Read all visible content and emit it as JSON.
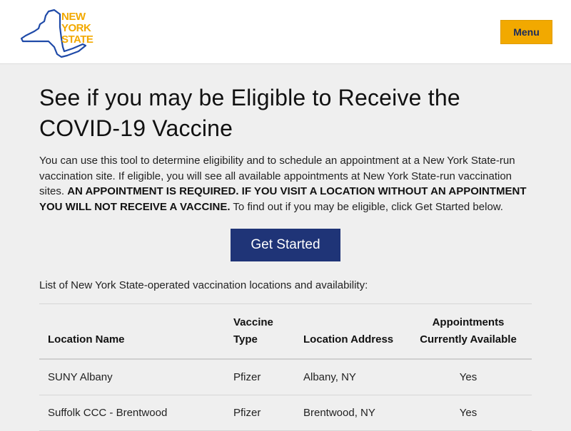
{
  "header": {
    "logo_lines": [
      "NEW",
      "YORK",
      "STATE"
    ],
    "menu_label": "Menu",
    "brand_color": "#f2a900"
  },
  "main": {
    "title_line1": "See if you may be Eligible to Receive the",
    "title_line2": "COVID-19 Vaccine",
    "intro_part1": "You can use this tool to determine eligibility and to schedule an appointment at a New York State-run vaccination site. If eligible, you will see all available appointments at New York State-run vaccination sites. ",
    "intro_bold": "AN APPOINTMENT IS REQUIRED. IF YOU VISIT A LOCATION WITHOUT AN APPOINTMENT YOU WILL NOT RECEIVE A VACCINE.",
    "intro_part2": " To find out if you may be eligible, click Get Started below.",
    "cta_label": "Get Started",
    "cta_color": "#1f3477",
    "list_caption": "List of New York State-operated vaccination locations and availability:"
  },
  "table": {
    "headers": [
      "Location Name",
      "Vaccine Type",
      "Location Address",
      "Appointments Currently Available"
    ],
    "rows": [
      [
        "SUNY Albany",
        "Pfizer",
        "Albany, NY",
        "Yes"
      ],
      [
        "Suffolk CCC - Brentwood",
        "Pfizer",
        "Brentwood, NY",
        "Yes"
      ]
    ]
  }
}
